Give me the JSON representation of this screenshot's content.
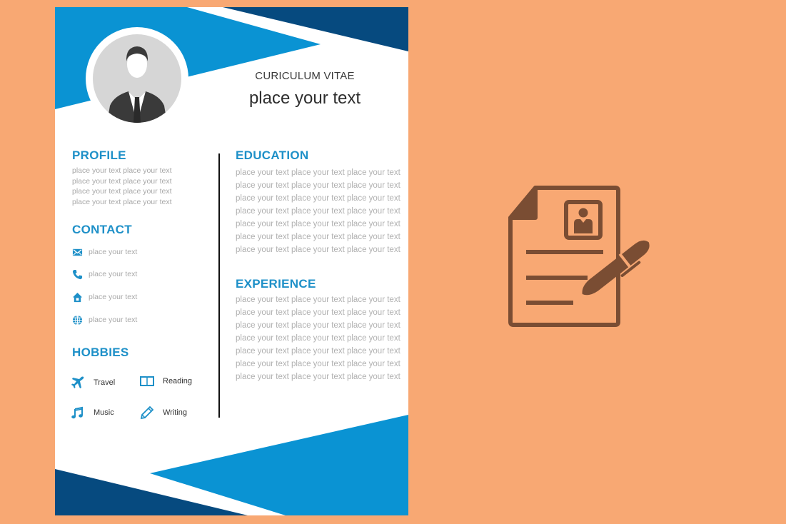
{
  "colors": {
    "background": "#F8A873",
    "accent_blue": "#1E90C8",
    "dark_blue": "#064A7F",
    "icon_brown": "#7A4D33"
  },
  "header": {
    "title": "CURICULUM VITAE",
    "name": "place your text",
    "avatar_icon": "person-suit-icon"
  },
  "profile": {
    "heading": "PROFILE",
    "lines": [
      "place your text place your text",
      "place your text place your text",
      "place your text place your text",
      "place your text place your text"
    ]
  },
  "contact": {
    "heading": "CONTACT",
    "items": [
      {
        "icon": "envelope-icon",
        "text": "place your text"
      },
      {
        "icon": "phone-icon",
        "text": "place your text"
      },
      {
        "icon": "home-icon",
        "text": "place your text"
      },
      {
        "icon": "globe-icon",
        "text": "place your text"
      }
    ]
  },
  "hobbies": {
    "heading": "HOBBIES",
    "items": [
      {
        "icon": "airplane-icon",
        "label": "Travel"
      },
      {
        "icon": "book-icon",
        "label": "Reading"
      },
      {
        "icon": "music-note-icon",
        "label": "Music"
      },
      {
        "icon": "pencil-icon",
        "label": "Writing"
      }
    ]
  },
  "education": {
    "heading": "EDUCATION",
    "lines": [
      "place your text place your text place your text",
      "place your text place your text place your text",
      "place your text place your text place your text",
      "place your text place your text place your text",
      "place your text place your text place your text",
      "place your text place your text place your text",
      "place your text place your text place your text"
    ]
  },
  "experience": {
    "heading": "EXPERIENCE",
    "lines": [
      "place your text place your text place your text",
      "place your text place your text place your text",
      "place your text place your text place your text",
      "place your text place your text place your text",
      "place your text place your text place your text",
      "place your text place your text place your text",
      "place your text place your text place your text"
    ]
  },
  "side_illustration": {
    "icon": "resume-document-with-pen-icon"
  }
}
